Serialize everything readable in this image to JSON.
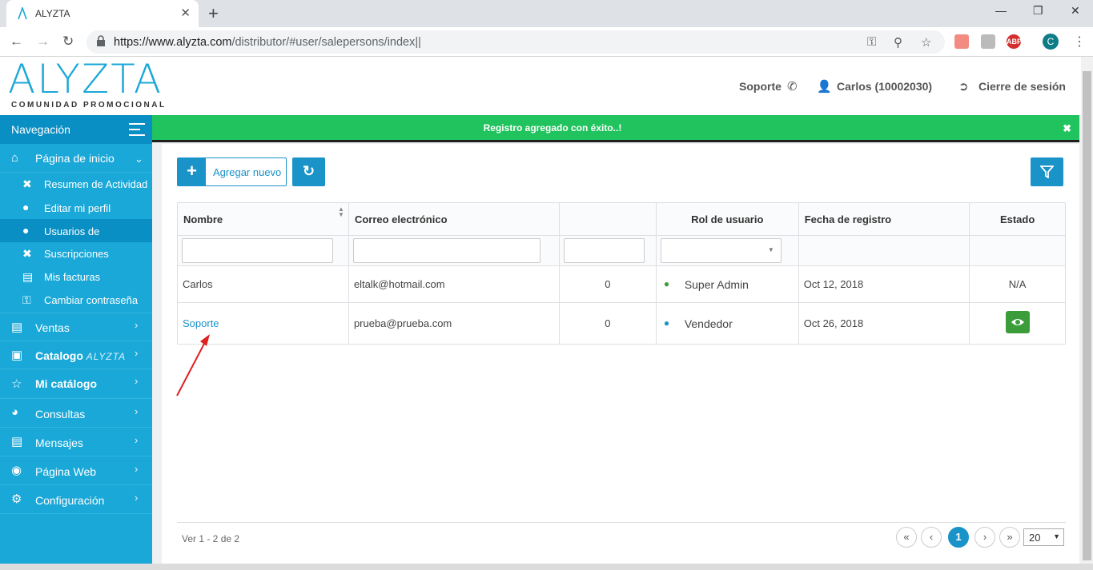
{
  "browser": {
    "tab_title": "ALYZTA",
    "tab_close": "✕",
    "new_tab": "+",
    "url_host": "https://www.alyzta.com",
    "url_path": "/distributor/#user/salepersons/index||",
    "win_minimize": "—",
    "win_restore": "❐",
    "win_close": "✕",
    "profile_initial": "C",
    "ext_abp": "ABP"
  },
  "header": {
    "logo": "ALYZTA",
    "logo_tagline": "COMUNIDAD PROMOCIONAL",
    "support": "Soporte",
    "user": "Carlos (10002030)",
    "logout": "Cierre de sesión"
  },
  "sidebar": {
    "title": "Navegación",
    "home": "Página de inicio",
    "sub": [
      {
        "label": "Resumen de Actividad"
      },
      {
        "label": "Editar mi perfil"
      },
      {
        "label": "Usuarios de"
      },
      {
        "label": "Suscripciones"
      },
      {
        "label": "Mis facturas"
      },
      {
        "label": "Cambiar contraseña"
      }
    ],
    "ventas": "Ventas",
    "catalogo": "Catalogo",
    "catalogo_brand": "ALYZTA",
    "mi_catalogo": "Mi catálogo",
    "consultas": "Consultas",
    "mensajes": "Mensajes",
    "pagina_web": "Página Web",
    "configuracion": "Configuración"
  },
  "alert": {
    "message": "Registro agregado con éxito..!",
    "close": "✖"
  },
  "toolbar": {
    "add_label": "Agregar nuevo"
  },
  "table": {
    "headers": [
      "Nombre",
      "Correo electrónico",
      "",
      "Rol de usuario",
      "Fecha de registro",
      "Estado"
    ],
    "rows": [
      {
        "name": "Carlos",
        "email": "eltalk@hotmail.com",
        "count": "0",
        "role": "Super Admin",
        "date": "Oct 12, 2018",
        "status": "N/A"
      },
      {
        "name": "Soporte",
        "email": "prueba@prueba.com",
        "count": "0",
        "role": "Vendedor",
        "date": "Oct 26, 2018",
        "status": ""
      }
    ]
  },
  "pagination": {
    "info": "Ver 1 - 2 de 2",
    "first": "«",
    "prev": "‹",
    "current": "1",
    "next": "›",
    "last": "»",
    "page_size": "20"
  },
  "colors": {
    "primary": "#1a93c9",
    "sidebar": "#1aa8d8",
    "success": "#20c35d",
    "annotation_arrow": "#e02020"
  }
}
